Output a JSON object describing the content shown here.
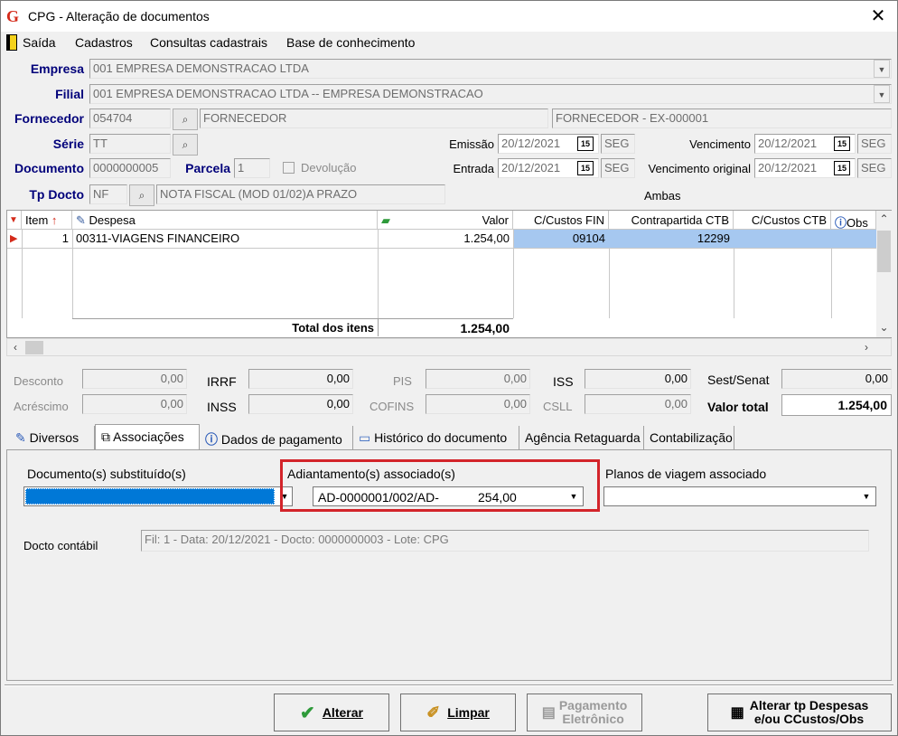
{
  "window": {
    "title": "CPG - Alteração de documentos",
    "close_glyph": "✕",
    "app_logo": "G"
  },
  "menu": {
    "items": [
      "Saída",
      "Cadastros",
      "Consultas cadastrais",
      "Base de conhecimento"
    ]
  },
  "form": {
    "empresa_label": "Empresa",
    "empresa_value": "001 EMPRESA DEMONSTRACAO LTDA",
    "filial_label": "Filial",
    "filial_value": "001 EMPRESA DEMONSTRACAO LTDA -- EMPRESA DEMONSTRACAO",
    "fornecedor_label": "Fornecedor",
    "fornecedor_code": "054704",
    "fornecedor_name": "FORNECEDOR",
    "fornecedor_desc": "FORNECEDOR - EX-000001",
    "serie_label": "Série",
    "serie_value": "TT",
    "emissao_label": "Emissão",
    "emissao_date": "20/12/2021",
    "emissao_day": "SEG",
    "vencimento_label": "Vencimento",
    "vencimento_date": "20/12/2021",
    "vencimento_day": "SEG",
    "documento_label": "Documento",
    "documento_value": "0000000005",
    "parcela_label": "Parcela",
    "parcela_value": "1",
    "devolucao_label": "Devolução",
    "entrada_label": "Entrada",
    "entrada_date": "20/12/2021",
    "entrada_day": "SEG",
    "venc_original_label": "Vencimento original",
    "venc_original_date": "20/12/2021",
    "venc_original_day": "SEG",
    "tpdocto_label": "Tp Docto",
    "tpdocto_code": "NF",
    "tpdocto_desc": "NOTA FISCAL (MOD 01/02)A PRAZO",
    "ambas_label": "Ambas",
    "cal_glyph": "15"
  },
  "grid": {
    "headers": {
      "item": "Item",
      "despesa": "Despesa",
      "valor": "Valor",
      "ccustos_fin": "C/Custos FIN",
      "contrapartida": "Contrapartida CTB",
      "ccustos_ctb": "C/Custos CTB",
      "obs": "Obs"
    },
    "rows": [
      {
        "item": "1",
        "despesa": "00311-VIAGENS FINANCEIRO",
        "valor": "1.254,00",
        "ccustos_fin": "09104",
        "contrapartida": "12299",
        "ccustos_ctb": ""
      }
    ],
    "total_label": "Total dos itens",
    "total_value": "1.254,00"
  },
  "totals": {
    "desconto_label": "Desconto",
    "desconto_value": "0,00",
    "acrescimo_label": "Acréscimo",
    "acrescimo_value": "0,00",
    "irrf_label": "IRRF",
    "irrf_value": "0,00",
    "inss_label": "INSS",
    "inss_value": "0,00",
    "pis_label": "PIS",
    "pis_value": "0,00",
    "cofins_label": "COFINS",
    "cofins_value": "0,00",
    "iss_label": "ISS",
    "iss_value": "0,00",
    "csll_label": "CSLL",
    "csll_value": "0,00",
    "sest_label": "Sest/Senat",
    "sest_value": "0,00",
    "valortotal_label": "Valor total",
    "valortotal_value": "1.254,00"
  },
  "tabs": [
    "Diversos",
    "Associações",
    "Dados de pagamento",
    "Histórico do documento",
    "Agência Retaguarda",
    "Contabilização"
  ],
  "assoc": {
    "docs_substituidos_label": "Documento(s) substituído(s)",
    "adiantamentos_label": "Adiantamento(s) associado(s)",
    "adiantamento_value": "AD-0000001/002/AD-",
    "adiantamento_amount": "254,00",
    "planos_label": "Planos de viagem associado",
    "docto_contabil_label": "Docto contábil",
    "docto_contabil_value": "Fil: 1 - Data: 20/12/2021 - Docto: 0000000003 - Lote: CPG"
  },
  "buttons": {
    "alterar": "Alterar",
    "limpar": "Limpar",
    "pagamento_line1": "Pagamento",
    "pagamento_line2": "Eletrônico",
    "alterar_tp_line1": "Alterar tp Despesas",
    "alterar_tp_line2": "e/ou CCustos/Obs"
  },
  "colors": {
    "label_blue": "#00007a",
    "row_selected": "#a6c8f0",
    "highlight_red": "#d3242a",
    "dropdown_selected": "#0078d7"
  }
}
